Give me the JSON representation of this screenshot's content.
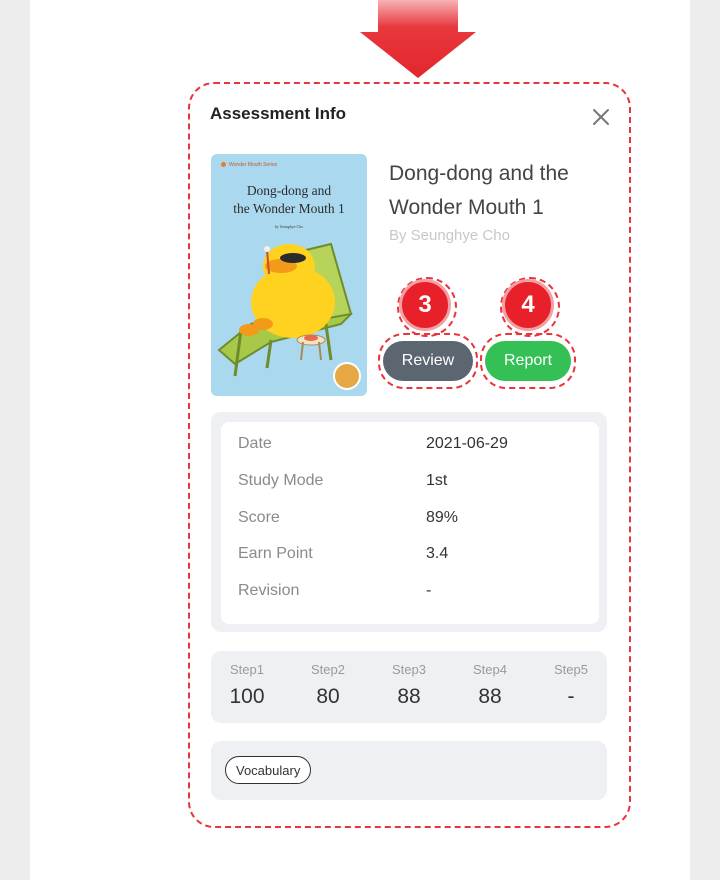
{
  "dialog": {
    "title": "Assessment Info",
    "close_icon": "close-icon"
  },
  "book": {
    "title": "Dong-dong and the Wonder Mouth 1",
    "author": "By Seunghye Cho",
    "cover": {
      "title": "Dong-dong and\nthe Wonder Mouth 1",
      "series_text": "Wonder Mouth Series",
      "author_text": "by Seunghye Cho",
      "background_color": "#a9d8ef"
    }
  },
  "annotations": {
    "badge_review": "3",
    "badge_report": "4",
    "highlight_color": "#e8343c",
    "pointer_icon": "down-arrow-icon"
  },
  "actions": {
    "review_label": "Review",
    "report_label": "Report",
    "review_color": "#5b6670",
    "report_color": "#34c055"
  },
  "info": {
    "rows": [
      {
        "label": "Date",
        "value": "2021-06-29"
      },
      {
        "label": "Study Mode",
        "value": "1st"
      },
      {
        "label": "Score",
        "value": "89%"
      },
      {
        "label": "Earn Point",
        "value": "3.4"
      },
      {
        "label": "Revision",
        "value": "-"
      }
    ]
  },
  "steps": [
    {
      "label": "Step1",
      "value": "100"
    },
    {
      "label": "Step2",
      "value": "80"
    },
    {
      "label": "Step3",
      "value": "88"
    },
    {
      "label": "Step4",
      "value": "88"
    },
    {
      "label": "Step5",
      "value": "-"
    }
  ],
  "tags": [
    "Vocabulary"
  ]
}
